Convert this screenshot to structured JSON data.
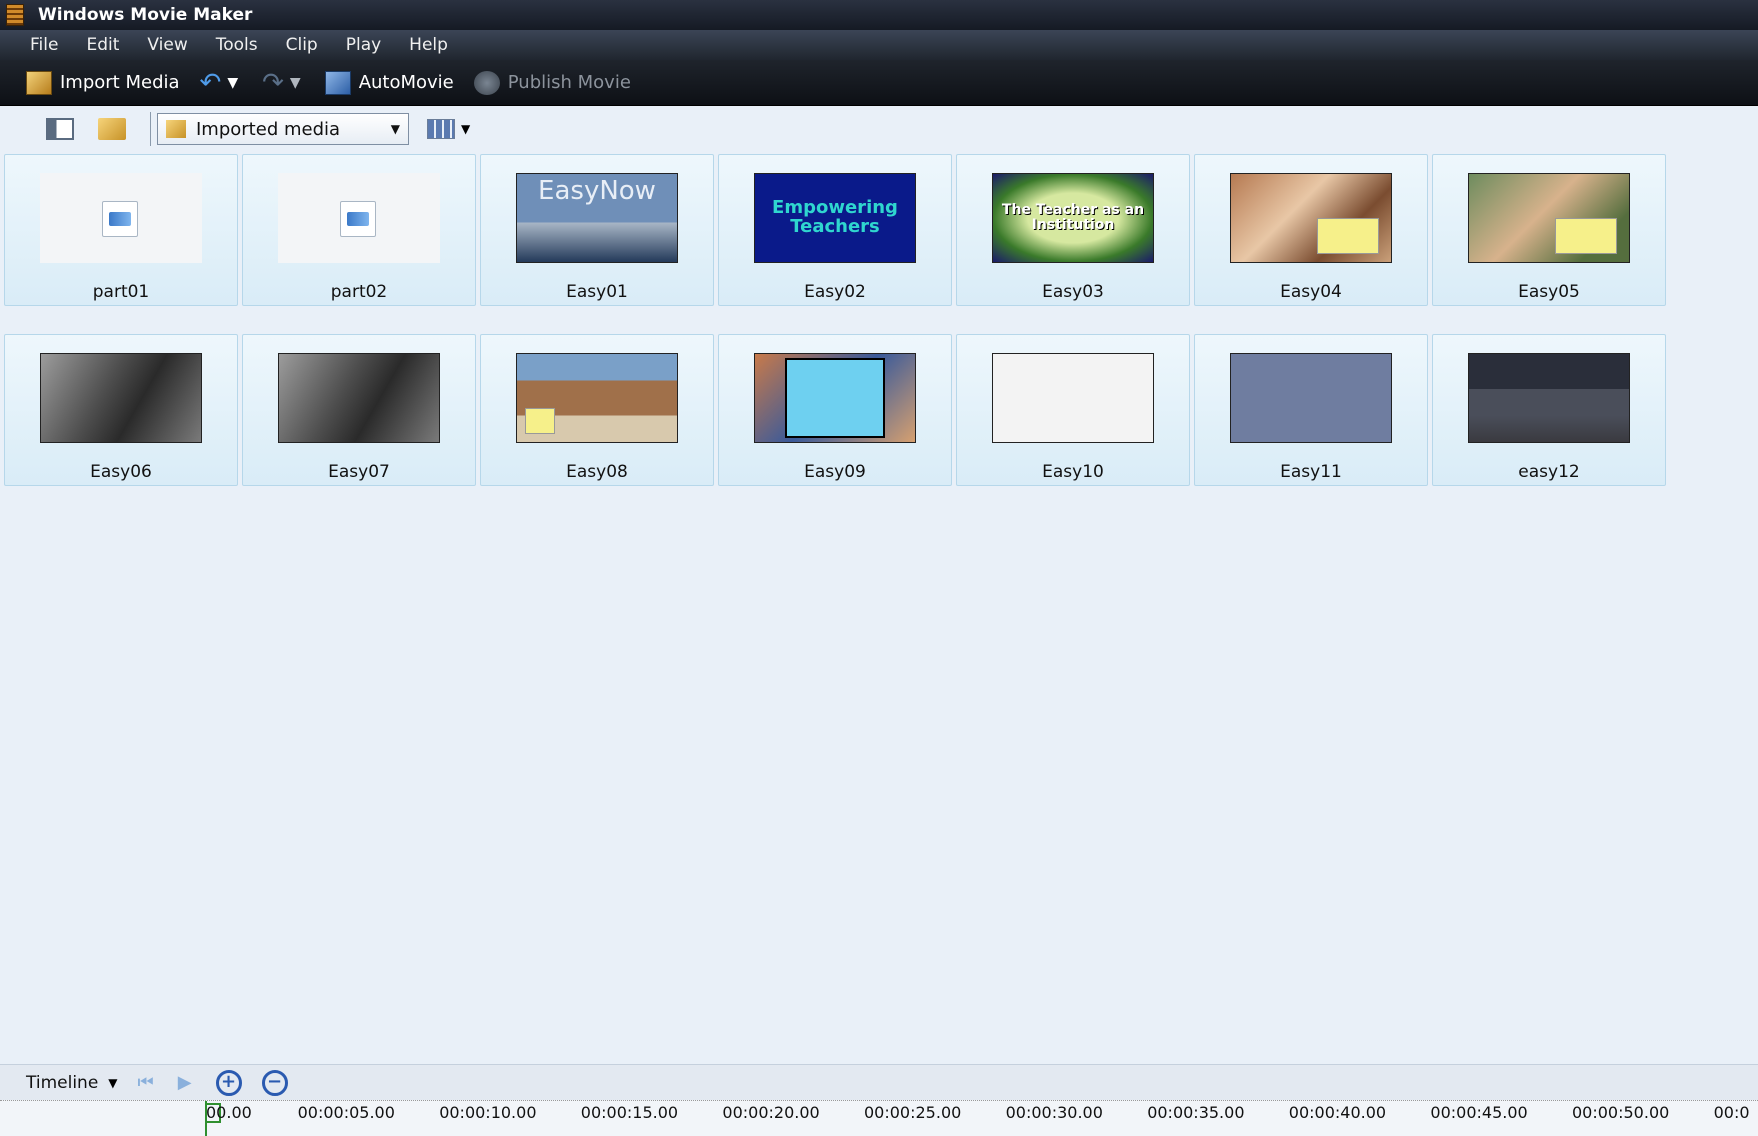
{
  "window": {
    "title": "Windows Movie Maker"
  },
  "menu": [
    "File",
    "Edit",
    "View",
    "Tools",
    "Clip",
    "Play",
    "Help"
  ],
  "toolbar": {
    "import_label": "Import Media",
    "automovie_label": "AutoMovie",
    "publish_label": "Publish Movie"
  },
  "collection": {
    "selected": "Imported media"
  },
  "media_items": [
    {
      "label": "part01",
      "art": "blank",
      "text": ""
    },
    {
      "label": "part02",
      "art": "blank",
      "text": ""
    },
    {
      "label": "Easy01",
      "art": "easynow",
      "text": "EasyNow"
    },
    {
      "label": "Easy02",
      "art": "empower",
      "text": "Empowering Teachers"
    },
    {
      "label": "Easy03",
      "art": "teacher",
      "text": "The Teacher as an Institution"
    },
    {
      "label": "Easy04",
      "art": "class1",
      "text": ""
    },
    {
      "label": "Easy05",
      "art": "class2",
      "text": ""
    },
    {
      "label": "Easy06",
      "art": "einstein",
      "text": ""
    },
    {
      "label": "Easy07",
      "art": "einstein",
      "text": ""
    },
    {
      "label": "Easy08",
      "art": "village",
      "text": ""
    },
    {
      "label": "Easy09",
      "art": "scissors",
      "text": ""
    },
    {
      "label": "Easy10",
      "art": "diagram",
      "text": ""
    },
    {
      "label": "Easy11",
      "art": "slides",
      "text": ""
    },
    {
      "label": "easy12",
      "art": "studio",
      "text": ""
    }
  ],
  "timeline": {
    "label": "Timeline",
    "ruler": [
      "00.00",
      "00:00:05.00",
      "00:00:10.00",
      "00:00:15.00",
      "00:00:20.00",
      "00:00:25.00",
      "00:00:30.00",
      "00:00:35.00",
      "00:00:40.00",
      "00:00:45.00",
      "00:00:50.00",
      "00:0"
    ]
  },
  "colors": {
    "accent": "#2a5ab0",
    "tile_border": "#b6d7ea",
    "background": "#e9f0f8"
  }
}
